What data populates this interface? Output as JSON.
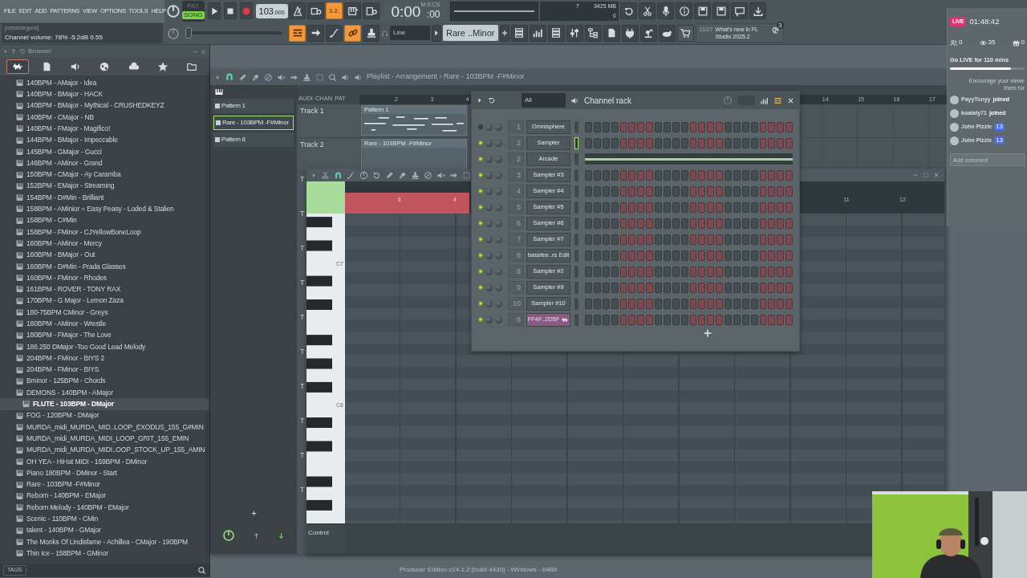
{
  "menu": [
    "FILE",
    "EDIT",
    "ADD",
    "PATTERNS",
    "VIEW",
    "OPTIONS",
    "TOOLS",
    "HELP"
  ],
  "hint": {
    "user": "[cesarsegura]",
    "text": "Channel volume: 78%  -5.2dB  0.55"
  },
  "modes": [
    {
      "label": "PAT",
      "selected": false
    },
    {
      "label": "SONG",
      "selected": true
    }
  ],
  "tempo": {
    "value": "103",
    "fraction": ".000"
  },
  "toggles_top": [
    {
      "on": false
    },
    {
      "on": false
    },
    {
      "on": true,
      "label": "3.2."
    },
    {
      "on": false
    },
    {
      "on": false
    }
  ],
  "time": {
    "unit": "M:S:CS",
    "value": "0:00",
    "fraction": ":00"
  },
  "meter": {
    "cpu": "7",
    "memory": "3425 MB",
    "polyphony": "0"
  },
  "pitch": {
    "level": 0
  },
  "toggles_bottom": [
    {
      "on": true
    },
    {
      "on": false
    },
    {
      "on": false
    },
    {
      "on": true
    },
    {
      "on": false
    }
  ],
  "snap": "Line",
  "pattern": "Rare ..Minor",
  "news": {
    "date": "11/27",
    "text": "What's new in FL Studio 2025.2",
    "badge": "3"
  },
  "browser": {
    "title": "Browser",
    "footer": "TAGS",
    "items": [
      {
        "label": "140BPM - AMajor - Idea",
        "selected": false
      },
      {
        "label": "140BPM - BMajor - HACK",
        "selected": false
      },
      {
        "label": "140BPM - BMajor - Mythical - CRUSHEDKEYZ",
        "selected": false
      },
      {
        "label": "140BPM - CMajor - NB",
        "selected": false
      },
      {
        "label": "140BPM - FMajor - Magifico!",
        "selected": false
      },
      {
        "label": "144BPM - BMajor - Impeccable",
        "selected": false
      },
      {
        "label": "145BPM - GMajor - Gucci",
        "selected": false
      },
      {
        "label": "146BPM - AMinor - Grand",
        "selected": false
      },
      {
        "label": "150BPM - CMajor - Ay Caramba",
        "selected": false
      },
      {
        "label": "152BPM - EMajor - Streaming",
        "selected": false
      },
      {
        "label": "154BPM - D#Min - Brilliant",
        "selected": false
      },
      {
        "label": "158BPM - AMinior = Easy Peasy - Loded & Stalien",
        "selected": false
      },
      {
        "label": "158BPM - C#Min",
        "selected": false
      },
      {
        "label": "158BPM - FMinor - CJYellowBoneLoop",
        "selected": false
      },
      {
        "label": "160BPM - AMinor - Mercy",
        "selected": false
      },
      {
        "label": "160BPM - BMajor - Out",
        "selected": false
      },
      {
        "label": "160BPM - D#Min - Prada Glasses",
        "selected": false
      },
      {
        "label": "160BPM - FMinor - Rhodes",
        "selected": false
      },
      {
        "label": "161BPM - ROVER - TONY RAX",
        "selected": false
      },
      {
        "label": "170BPM - G Major - Lemon Zaza",
        "selected": false
      },
      {
        "label": "180-75BPM CMinor - Greys",
        "selected": false
      },
      {
        "label": "180BPM - AMinor - Wrestle",
        "selected": false
      },
      {
        "label": "180BPM - FMajor - The Love",
        "selected": false
      },
      {
        "label": "186.250 DMajor -Too Good Lead Melody",
        "selected": false
      },
      {
        "label": "204BPM - FMinor - BIYS 2",
        "selected": false
      },
      {
        "label": "204BPM - FMinor - BIYS",
        "selected": false
      },
      {
        "label": "Bminor - 125BPM - Chords",
        "selected": false
      },
      {
        "label": "DEMONS - 140BPM - AMajor",
        "selected": false
      },
      {
        "label": "FLUTE - 103BPM - DMajor",
        "selected": true
      },
      {
        "label": "FOG - 120BPM - DMajor",
        "selected": false
      },
      {
        "label": "MURDA_midi_MURDA_MID..LOOP_EXODUS_155_G#MIN",
        "selected": false
      },
      {
        "label": "MURDA_midi_MURDA_MIDI_LOOP_GRIT_155_EMIN",
        "selected": false
      },
      {
        "label": "MURDA_midi_MURDA_MIDI..OOP_STOCK_UP_155_AMIN",
        "selected": false
      },
      {
        "label": "OH YEA - HiHat MIDI - 159BPM - DMinor",
        "selected": false
      },
      {
        "label": "Piano 180BPM - DMinor - Start",
        "selected": false
      },
      {
        "label": "Rare - 103BPM -F#Minor",
        "selected": false
      },
      {
        "label": "Reborn - 140BPM - EMajor",
        "selected": false
      },
      {
        "label": "Reborn Melody - 140BPM - EMajor",
        "selected": false
      },
      {
        "label": "Scenic - 110BPM - CMin",
        "selected": false
      },
      {
        "label": "talent - 140BPM - GMajor",
        "selected": false
      },
      {
        "label": "The Monks Of Lindisfame - Achillea - CMajor - 190BPM",
        "selected": false
      },
      {
        "label": "Thin Ice - 158BPM - GMinor",
        "selected": false
      }
    ]
  },
  "playlist": {
    "breadcrumb": "Playlist - Arrangement › Rare - 103BPM -F#Minor",
    "patterns": [
      {
        "label": "Pattern 1",
        "selected": false
      },
      {
        "label": "Rare - 103BPM -F#Minor",
        "selected": true
      },
      {
        "label": "Pattern 8",
        "selected": false
      }
    ],
    "tabs": [
      "AUDI",
      "CHAN",
      "PAT"
    ],
    "ruler": [
      "2",
      "3",
      "4",
      "14",
      "15",
      "16",
      "17"
    ],
    "tracks": [
      {
        "name": "Track 1",
        "clip": "Pattern 1",
        "kind": "notes"
      },
      {
        "name": "Track 2",
        "clip": "Rare - 103BPM -F#Minor",
        "kind": "empty"
      }
    ],
    "more_tracks": [
      "T",
      "T",
      "T",
      "T",
      "T",
      "T",
      "T",
      "T",
      "T",
      "T"
    ]
  },
  "piano_roll": {
    "ruler": [
      "3",
      "4",
      "11",
      "12"
    ],
    "keys": [
      "C7",
      "C6"
    ],
    "control": "Control"
  },
  "channel_rack": {
    "title": "Channel rack",
    "filter": "All",
    "channels": [
      {
        "number": "1",
        "name": "Omnisphere",
        "enabled": false,
        "selected": false,
        "kind": "steps",
        "color": "#4e575c"
      },
      {
        "number": "2",
        "name": "Sampler",
        "enabled": true,
        "selected": true,
        "kind": "steps",
        "color": "#4e575c"
      },
      {
        "number": "2",
        "name": "Arcade",
        "enabled": true,
        "selected": false,
        "kind": "pianoroll",
        "color": "#4e575c"
      },
      {
        "number": "3",
        "name": "Sampler #3",
        "enabled": true,
        "selected": false,
        "kind": "steps",
        "color": "#4e575c"
      },
      {
        "number": "4",
        "name": "Sampler #4",
        "enabled": true,
        "selected": false,
        "kind": "steps",
        "color": "#4e575c"
      },
      {
        "number": "5",
        "name": "Sampler #5",
        "enabled": true,
        "selected": false,
        "kind": "steps",
        "color": "#4e575c"
      },
      {
        "number": "6",
        "name": "Sampler #6",
        "enabled": true,
        "selected": false,
        "kind": "steps",
        "color": "#4e575c"
      },
      {
        "number": "7",
        "name": "Sampler #7",
        "enabled": true,
        "selected": false,
        "kind": "steps",
        "color": "#4e575c"
      },
      {
        "number": "8",
        "name": "bassfee..rs Edit",
        "enabled": true,
        "selected": false,
        "kind": "steps",
        "color": "#4e575c"
      },
      {
        "number": "8",
        "name": "Sampler #2",
        "enabled": true,
        "selected": false,
        "kind": "steps",
        "color": "#4e575c"
      },
      {
        "number": "9",
        "name": "Sampler #9",
        "enabled": true,
        "selected": false,
        "kind": "steps",
        "color": "#4e575c"
      },
      {
        "number": "10",
        "name": "Sampler #10",
        "enabled": true,
        "selected": false,
        "kind": "steps",
        "color": "#4e575c"
      },
      {
        "number": "6",
        "name": "FF4F..2D5F",
        "enabled": true,
        "selected": false,
        "kind": "audio",
        "color": "#8a5a82"
      }
    ]
  },
  "stream": {
    "live": "LIVE",
    "clock": "01:48:42",
    "followers": "0",
    "viewers": "35",
    "gifts": "0",
    "goal": "Go LIVE for 110 mins",
    "goal_bar": {
      "level": 0.82
    },
    "prompt": [
      "Encourage your viewe",
      "them for"
    ],
    "chat": [
      {
        "kind": "join",
        "user": "PayyTonyy",
        "action": "joined"
      },
      {
        "kind": "join",
        "user": "koalaty71",
        "action": "joined"
      },
      {
        "kind": "message",
        "user": "John Pizzle",
        "badge": "13"
      },
      {
        "kind": "message",
        "user": "John Pizzle",
        "badge": "13"
      }
    ],
    "comment_placeholder": "Add comment"
  },
  "footer": "Producer Edition v24.1.2 [build 4430] - Windows - 64Bit"
}
